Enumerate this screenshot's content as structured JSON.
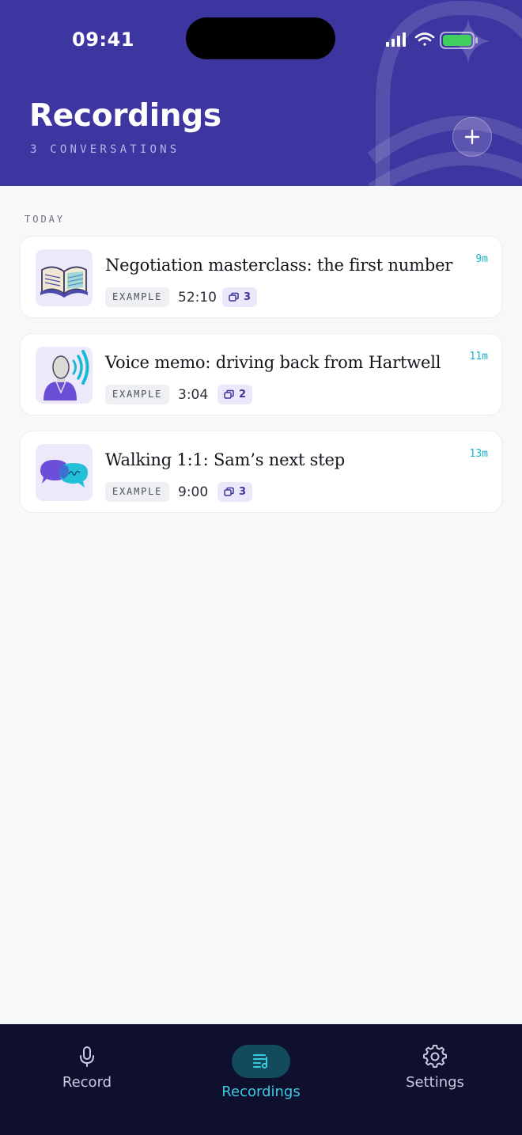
{
  "status_bar": {
    "time": "09:41"
  },
  "header": {
    "title": "Recordings",
    "subtitle": "3 CONVERSATIONS",
    "add_icon": "plus-icon"
  },
  "section": {
    "label": "TODAY"
  },
  "recordings": [
    {
      "title": "Negotiation masterclass: the first number",
      "badge": "EXAMPLE",
      "duration": "52:10",
      "clips": "3",
      "age": "9m",
      "icon": "open-book-illustration"
    },
    {
      "title": "Voice memo: driving back from Hartwell",
      "badge": "EXAMPLE",
      "duration": "3:04",
      "clips": "2",
      "age": "11m",
      "icon": "speaking-person-illustration"
    },
    {
      "title": "Walking 1:1: Sam’s next step",
      "badge": "EXAMPLE",
      "duration": "9:00",
      "clips": "3",
      "age": "13m",
      "icon": "chat-bubbles-illustration"
    }
  ],
  "tabs": [
    {
      "label": "Record",
      "icon": "microphone-icon",
      "active": false
    },
    {
      "label": "Recordings",
      "icon": "playlist-icon",
      "active": true
    },
    {
      "label": "Settings",
      "icon": "gear-icon",
      "active": false
    }
  ],
  "colors": {
    "header": "#3d35a0",
    "accent": "#1cb3c9",
    "tabbar": "#0f0f2e",
    "active_tab": "#3ec9e0"
  }
}
